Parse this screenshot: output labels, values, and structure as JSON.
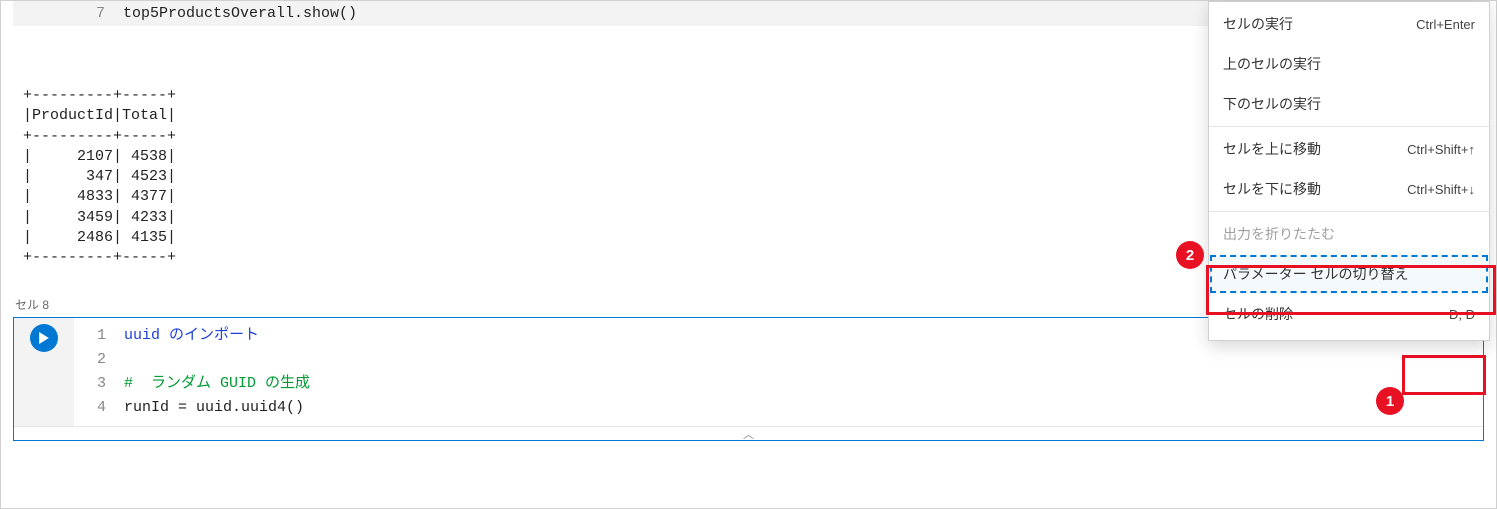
{
  "cell7": {
    "lineno": "7",
    "code": "top5ProductsOverall.show()"
  },
  "output_lines": [
    "+---------+-----+",
    "|ProductId|Total|",
    "+---------+-----+",
    "|     2107| 4538|",
    "|      347| 4523|",
    "|     4833| 4377|",
    "|     3459| 4233|",
    "|     2486| 4135|",
    "+---------+-----+"
  ],
  "cell8": {
    "label": "セル 8",
    "lines": [
      {
        "n": "1",
        "cls": "tok-import",
        "text": "uuid のインポート"
      },
      {
        "n": "2",
        "cls": "tok-code",
        "text": ""
      },
      {
        "n": "3",
        "cls": "tok-comment",
        "text": "#  ランダム GUID の生成"
      },
      {
        "n": "4",
        "cls": "tok-code",
        "text": "runId = uuid.uuid4()"
      }
    ],
    "more": "···"
  },
  "collapse_glyph": "︿",
  "menu": [
    {
      "label": "セルの実行",
      "shortcut": "Ctrl+Enter",
      "disabled": false
    },
    {
      "label": "上のセルの実行",
      "shortcut": "",
      "disabled": false
    },
    {
      "label": "下のセルの実行",
      "shortcut": "",
      "disabled": false
    },
    {
      "sep": true
    },
    {
      "label": "セルを上に移動",
      "shortcut": "Ctrl+Shift+↑",
      "disabled": false
    },
    {
      "label": "セルを下に移動",
      "shortcut": "Ctrl+Shift+↓",
      "disabled": false
    },
    {
      "sep": true
    },
    {
      "label": "出力を折りたたむ",
      "shortcut": "",
      "disabled": true
    },
    {
      "label": "パラメーター セルの切り替え",
      "shortcut": "",
      "disabled": false,
      "selected": true
    },
    {
      "label": "セルの削除",
      "shortcut": "D, D",
      "disabled": false
    }
  ],
  "badges": {
    "one": "1",
    "two": "2"
  }
}
